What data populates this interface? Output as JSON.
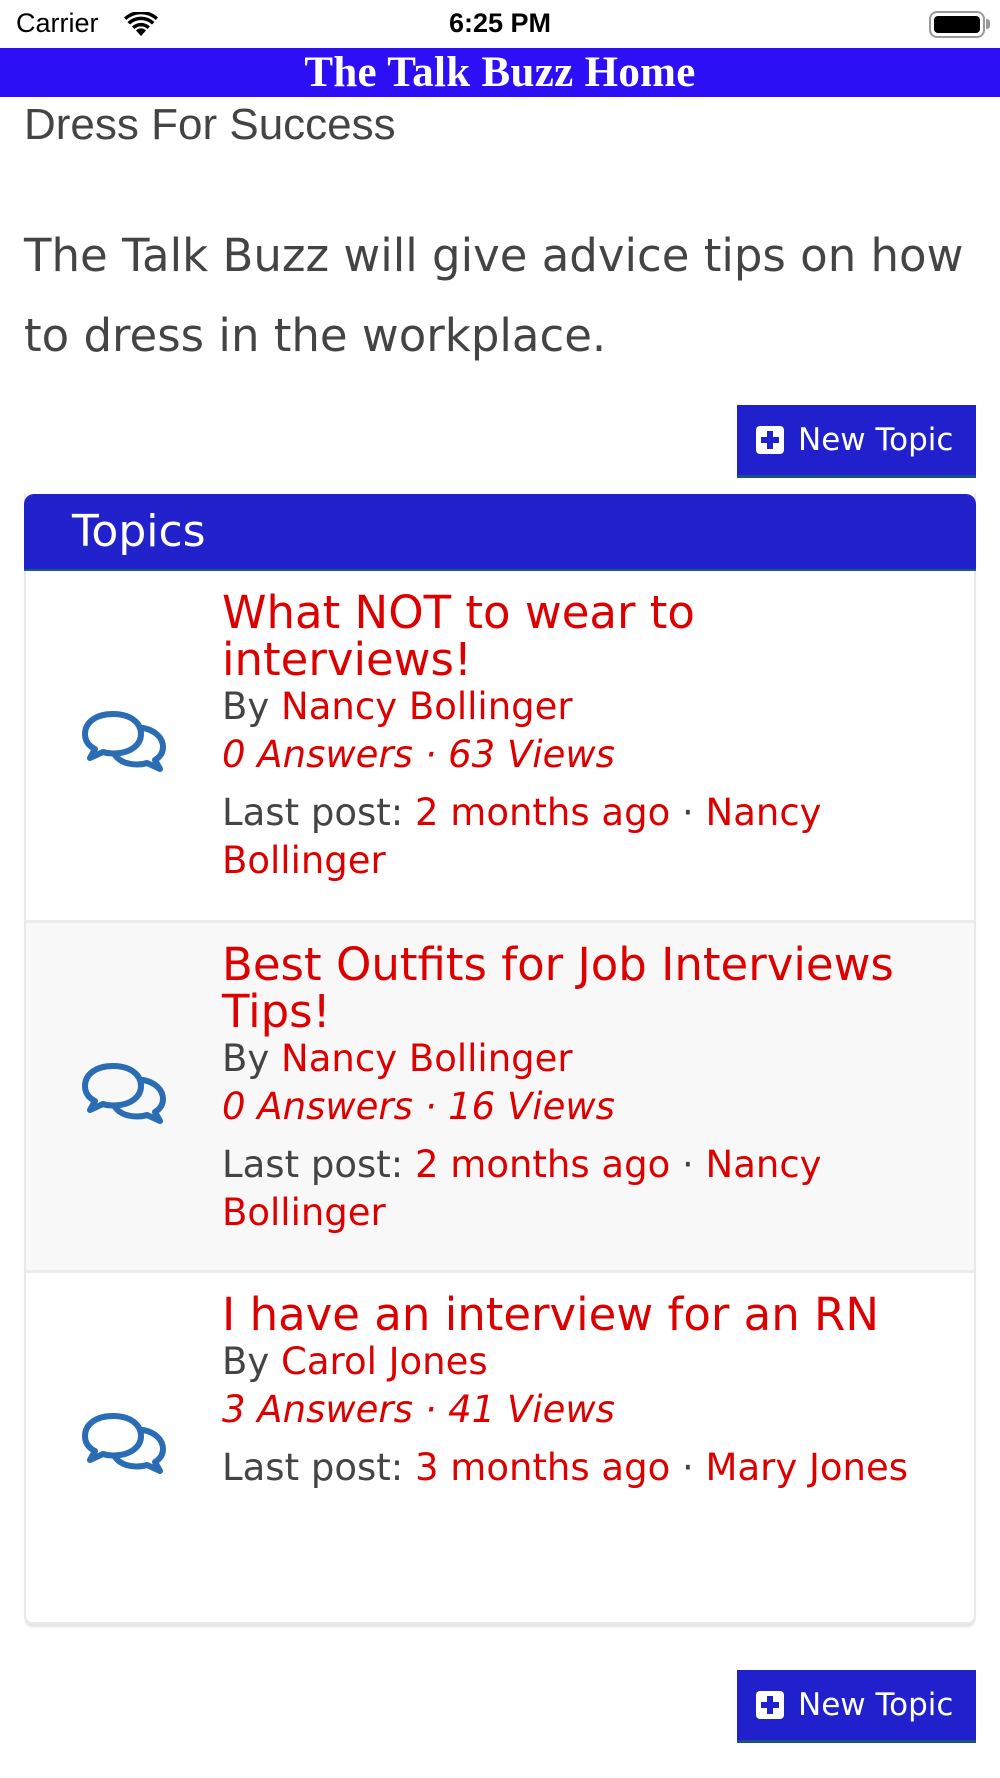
{
  "status_bar": {
    "carrier": "Carrier",
    "time": "6:25 PM",
    "wifi_icon": "wifi-icon",
    "battery_icon": "battery-full-icon"
  },
  "header": {
    "title": "The Talk Buzz Home",
    "background_color": "#2c0ff5"
  },
  "page": {
    "title": "Dress For Success",
    "description": "The Talk Buzz will give advice tips on how to dress in the workplace."
  },
  "new_topic_button": {
    "label": "New Topic",
    "icon": "plus-square-icon",
    "background_color": "#2020cc"
  },
  "topics": {
    "header_label": "Topics",
    "header_color": "#2222cc",
    "link_color": "#dd0000",
    "icon": "comments-icon",
    "items": [
      {
        "title": "What NOT to wear to interviews!",
        "by_label": "By",
        "author": "Nancy Bollinger",
        "stats": "0 Answers · 63 Views",
        "last_post_label": "Last post:",
        "last_post_time": "2 months ago",
        "separator": "·",
        "last_post_author": "Nancy Bollinger"
      },
      {
        "title": "Best Outfits for Job Interviews Tips!",
        "by_label": "By",
        "author": "Nancy Bollinger",
        "stats": "0 Answers · 16 Views",
        "last_post_label": "Last post:",
        "last_post_time": "2 months ago",
        "separator": "·",
        "last_post_author": "Nancy Bollinger"
      },
      {
        "title": "I have an interview for an RN",
        "by_label": "By",
        "author": "Carol Jones",
        "stats": "3 Answers · 41 Views",
        "last_post_label": "Last post:",
        "last_post_time": "3 months ago",
        "separator": "·",
        "last_post_author": "Mary Jones"
      }
    ]
  }
}
